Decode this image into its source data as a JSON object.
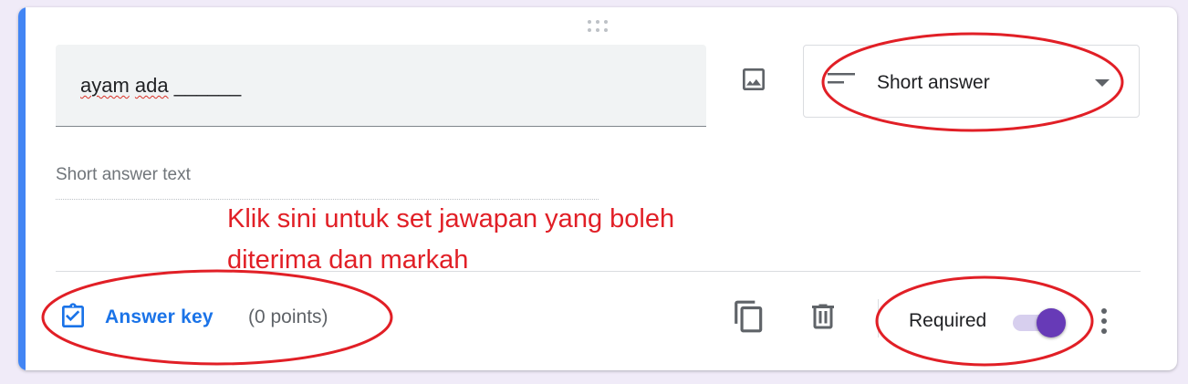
{
  "question": {
    "text_word1": "ayam",
    "text_word2": "ada",
    "text_rest": "______"
  },
  "type_select": {
    "icon": "short-text-lines-icon",
    "selected": "Short answer"
  },
  "answer": {
    "placeholder": "Short answer text"
  },
  "annotation": {
    "line1": "Klik sini untuk set jawapan yang boleh",
    "line2": "diterima dan markah"
  },
  "footer": {
    "answer_key_label": "Answer key",
    "points": "(0 points)",
    "required_label": "Required",
    "required_on": true
  },
  "colors": {
    "accent": "#4285f4",
    "link_blue": "#1a73e8",
    "toggle_purple": "#673ab7",
    "annotation_red": "#e11f26"
  }
}
